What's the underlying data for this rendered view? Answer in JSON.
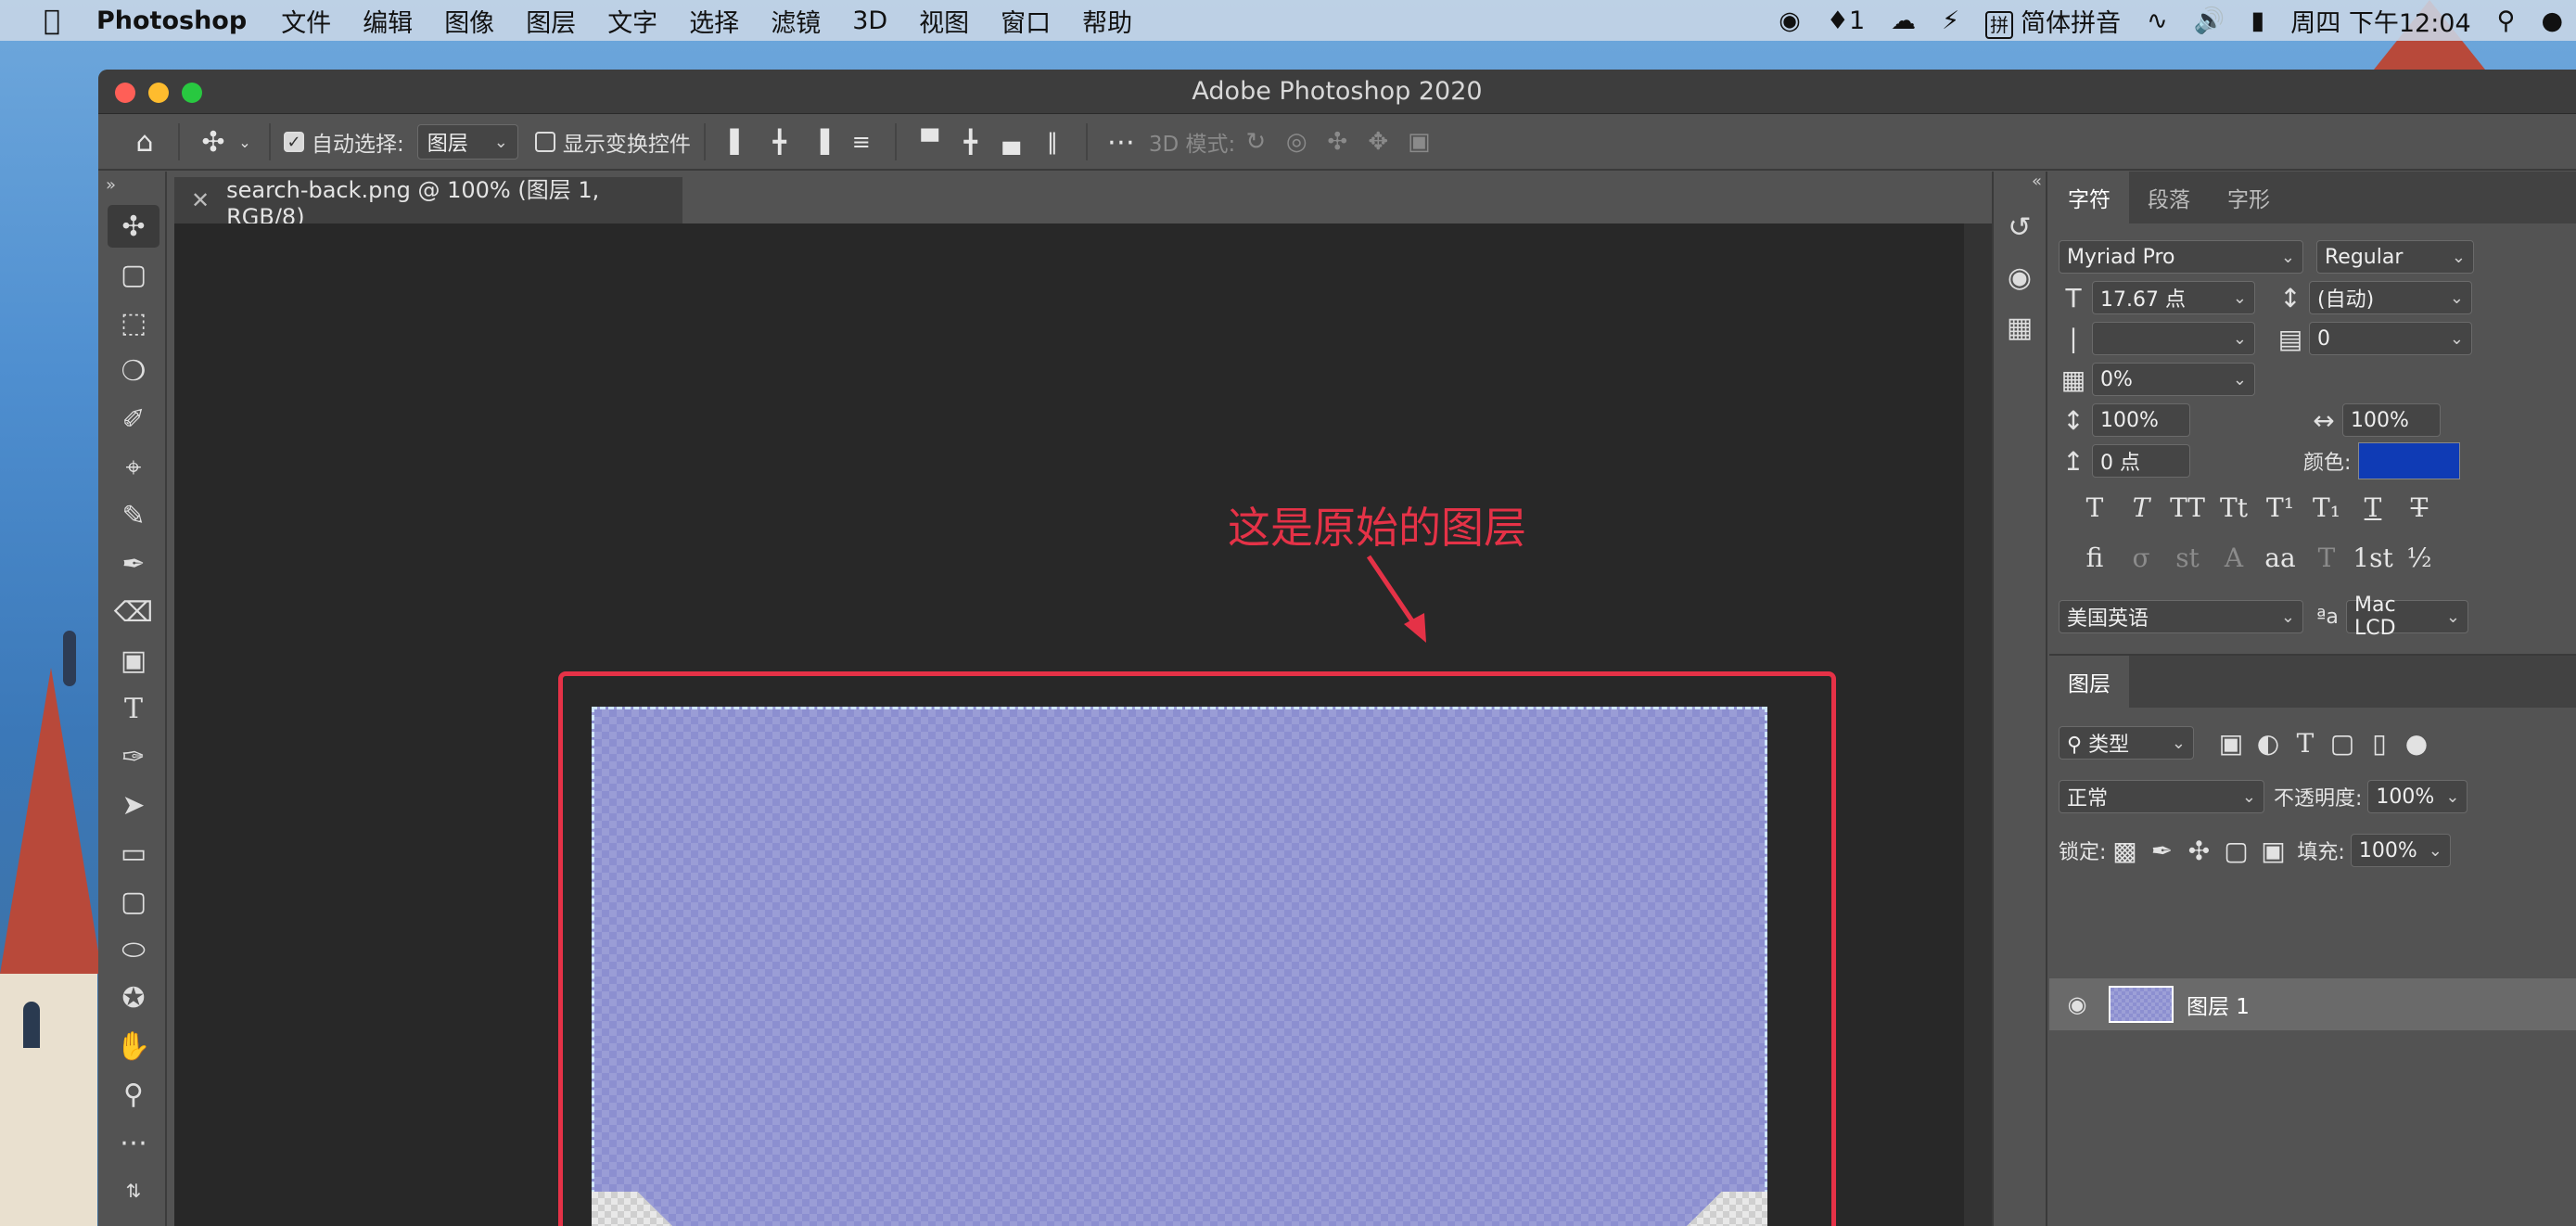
{
  "menubar": {
    "app_name": "Photoshop",
    "items": [
      "文件",
      "编辑",
      "图像",
      "图层",
      "文字",
      "选择",
      "滤镜",
      "3D",
      "视图",
      "窗口",
      "帮助"
    ],
    "qq_badge": "1",
    "ime_name": "简体拼音",
    "ime_glyph": "拼",
    "datetime": "周四 下午12:04"
  },
  "window": {
    "title": "Adobe Photoshop 2020"
  },
  "options_bar": {
    "auto_select_label": "自动选择:",
    "auto_select_target": "图层",
    "show_transform_label": "显示变换控件",
    "mode_3d_label": "3D 模式:"
  },
  "document": {
    "tab_title": "search-back.png @ 100% (图层 1, RGB/8)",
    "annotation": "这是原始的图层"
  },
  "character_panel": {
    "tabs": [
      "字符",
      "段落",
      "字形"
    ],
    "font_family": "Myriad Pro",
    "font_style": "Regular",
    "font_size": "17.67 点",
    "leading": "(自动)",
    "kerning": "",
    "tracking": "0",
    "tsume": "0%",
    "vertical_scale": "100%",
    "horizontal_scale": "100%",
    "baseline_shift": "0 点",
    "color_label": "颜色:",
    "color_value": "#0f3bb5",
    "language": "美国英语",
    "aa_label": "ªa",
    "anti_alias": "Mac LCD"
  },
  "layers_panel": {
    "tab": "图层",
    "filter_kind": "类型",
    "blend_mode": "正常",
    "opacity_label": "不透明度:",
    "opacity_value": "100%",
    "lock_label": "锁定:",
    "fill_label": "填充:",
    "fill_value": "100%",
    "layers": [
      {
        "name": "图层 1",
        "visible": true
      }
    ]
  },
  "colors": {
    "accent_red": "#e53247",
    "panel_bg": "#535353",
    "canvas_bg": "#282828"
  }
}
